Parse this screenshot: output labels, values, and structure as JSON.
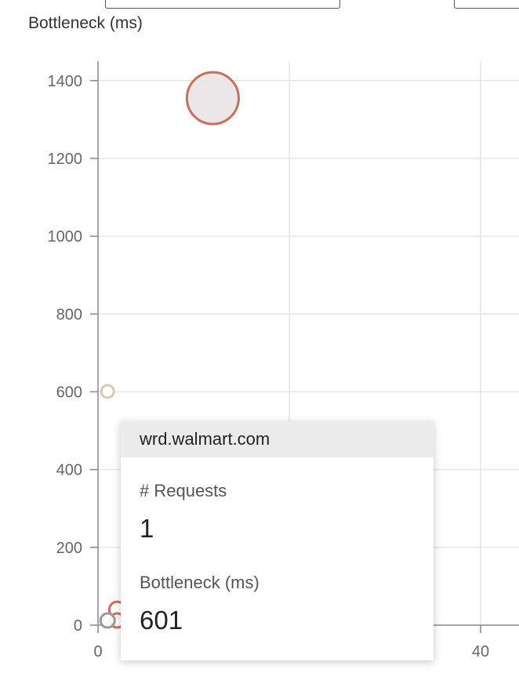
{
  "chart_data": {
    "type": "scatter",
    "ylabel": "Bottleneck (ms)",
    "xlabel": "",
    "xlim": [
      0,
      44
    ],
    "ylim": [
      0,
      1450
    ],
    "x_ticks": [
      0,
      20,
      40
    ],
    "x_tick_labels": [
      "0",
      "",
      "40"
    ],
    "y_ticks": [
      0,
      200,
      400,
      600,
      800,
      1000,
      1200,
      1400
    ],
    "grid": true,
    "points": [
      {
        "x": 12,
        "y": 1355,
        "size": 33,
        "color": "#c8705a",
        "fill": "#e9e3e4"
      },
      {
        "x": 1,
        "y": 601,
        "size": 8,
        "color": "#d8c8b8",
        "fill": "#ffffff"
      },
      {
        "x": 2,
        "y": 40,
        "size": 10,
        "color": "#c8705a",
        "fill": "#ffffff"
      },
      {
        "x": 2,
        "y": 12,
        "size": 9,
        "color": "#c8705a",
        "fill": "#ffffff"
      },
      {
        "x": 1,
        "y": 12,
        "size": 9,
        "color": "#999999",
        "fill": "#ffffff"
      }
    ]
  },
  "tooltip": {
    "title": "wrd.walmart.com",
    "requests_label": "# Requests",
    "requests_value": "1",
    "bottleneck_label": "Bottleneck (ms)",
    "bottleneck_value": "601"
  }
}
